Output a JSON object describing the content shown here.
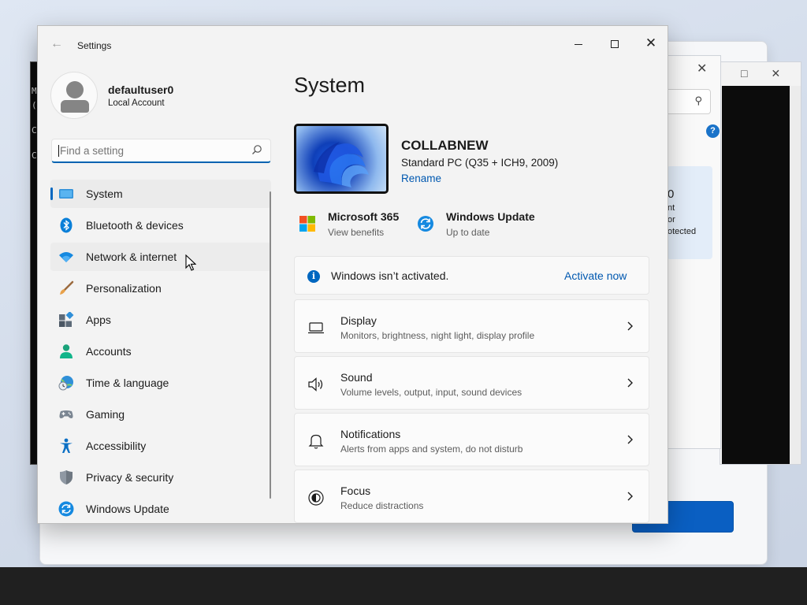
{
  "settings": {
    "app_title": "Settings",
    "user": {
      "name": "defaultuser0",
      "account_type": "Local Account"
    },
    "search": {
      "placeholder": "Find a setting"
    },
    "nav": [
      {
        "label": "System",
        "icon": "system-icon"
      },
      {
        "label": "Bluetooth & devices",
        "icon": "bluetooth-icon"
      },
      {
        "label": "Network & internet",
        "icon": "wifi-icon"
      },
      {
        "label": "Personalization",
        "icon": "brush-icon"
      },
      {
        "label": "Apps",
        "icon": "apps-icon"
      },
      {
        "label": "Accounts",
        "icon": "accounts-icon"
      },
      {
        "label": "Time & language",
        "icon": "globe-clock-icon"
      },
      {
        "label": "Gaming",
        "icon": "gamepad-icon"
      },
      {
        "label": "Accessibility",
        "icon": "accessibility-icon"
      },
      {
        "label": "Privacy & security",
        "icon": "shield-icon"
      },
      {
        "label": "Windows Update",
        "icon": "windows-update-icon"
      }
    ],
    "selected_nav": "System",
    "page_title": "System",
    "device": {
      "name": "COLLABNEW",
      "model": "Standard PC (Q35 + ICH9, 2009)",
      "rename_label": "Rename"
    },
    "quick_links": {
      "m365": {
        "title": "Microsoft 365",
        "subtitle": "View benefits",
        "icon": "microsoft-logo-icon"
      },
      "windows_update": {
        "title": "Windows Update",
        "subtitle": "Up to date",
        "icon": "sync-icon"
      }
    },
    "activation": {
      "message": "Windows isn’t activated.",
      "action": "Activate now",
      "icon": "info-icon"
    },
    "cards": [
      {
        "title": "Display",
        "description": "Monitors, brightness, night light, display profile",
        "icon": "display-icon"
      },
      {
        "title": "Sound",
        "description": "Volume levels, output, input, sound devices",
        "icon": "speaker-icon"
      },
      {
        "title": "Notifications",
        "description": "Alerts from apps and system, do not disturb",
        "icon": "bell-icon"
      },
      {
        "title": "Focus",
        "description": "Reduce distractions",
        "icon": "focus-icon"
      }
    ]
  },
  "background": {
    "account_card": {
      "name": "r0",
      "lines": [
        "nt",
        "or",
        "otected"
      ]
    },
    "console_lines": [
      "M",
      "(",
      "C",
      "C"
    ],
    "help_glyph": "?"
  },
  "colors": {
    "accent": "#0067c0",
    "link": "#0058b0",
    "taskbar": "#202020"
  }
}
